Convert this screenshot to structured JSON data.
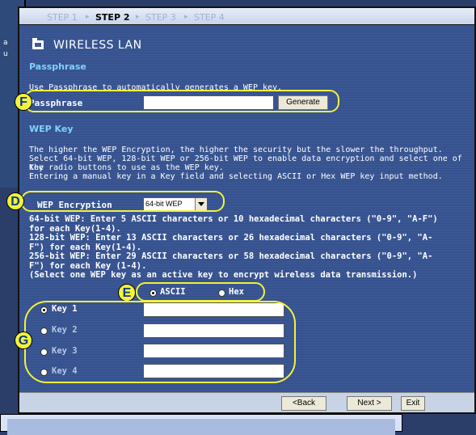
{
  "steps": [
    "STEP 1",
    "STEP 2",
    "STEP 3",
    "STEP 4"
  ],
  "active_step": "STEP 2",
  "step_sep": "▸",
  "title": "WIRELESS LAN",
  "passphrase_section": {
    "heading": "Passphrase",
    "desc": "Use Passphrase to automatically generates a WEP key.",
    "label": "Passphrase",
    "value": "",
    "generate_label": "Generate"
  },
  "wep_section": {
    "heading": "WEP Key",
    "desc1": "The higher the WEP Encryption, the higher the security but the slower the throughput.",
    "desc2": "Select 64-bit WEP, 128-bit WEP or 256-bit WEP to enable data encryption and select one of the",
    "desc3": "Key radio buttons to use as the WEP key.",
    "desc4": "Entering a manual key in a Key field and selecting ASCII or Hex WEP key input method.",
    "encryption_label": "WEP Encryption",
    "encryption_value": "64-bit WEP",
    "info": [
      "64-bit WEP: Enter 5 ASCII characters or 10 hexadecimal characters (\"0-9\", \"A-F\")",
      "for each Key(1-4).",
      "128-bit WEP: Enter 13 ASCII characters or 26 hexadecimal characters (\"0-9\", \"A-",
      "F\") for each Key(1-4).",
      "256-bit WEP: Enter 29 ASCII characters or 58 hexadecimal characters (\"0-9\", \"A-",
      "F\") for each Key (1-4).",
      "(Select one WEP key as an active key to encrypt wireless data transmission.)"
    ],
    "ascii_label": "ASCII",
    "hex_label": "Hex",
    "keys": [
      {
        "label": "Key 1",
        "value": ""
      },
      {
        "label": "Key 2",
        "value": ""
      },
      {
        "label": "Key 3",
        "value": ""
      },
      {
        "label": "Key 4",
        "value": ""
      }
    ]
  },
  "callouts": {
    "F": "F",
    "D": "D",
    "E": "E",
    "G": "G"
  },
  "footer": {
    "back": "<Back",
    "next": "Next >",
    "exit": "Exit"
  },
  "back_window_text": [
    "a",
    "u"
  ]
}
